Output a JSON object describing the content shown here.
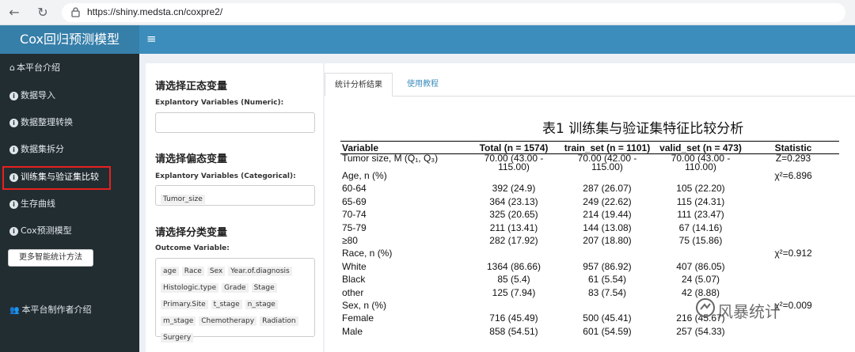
{
  "browser": {
    "url": "https://shiny.medsta.cn/coxpre2/"
  },
  "app": {
    "title": "Cox回归预测模型"
  },
  "sidebar": {
    "items": [
      {
        "label": "本平台介绍",
        "icon": "home-icon"
      },
      {
        "label": "数据导入",
        "icon": "info-icon"
      },
      {
        "label": "数据整理转换",
        "icon": "info-icon"
      },
      {
        "label": "数据集拆分",
        "icon": "info-icon"
      },
      {
        "label": "训练集与验证集比较",
        "icon": "info-icon"
      },
      {
        "label": "生存曲线",
        "icon": "info-icon"
      },
      {
        "label": "Cox预测模型",
        "icon": "info-icon"
      }
    ],
    "more_button": "更多智能统计方法",
    "author": "本平台制作者介绍"
  },
  "left_panel": {
    "numeric_title": "请选择正态变量",
    "numeric_label": "Explantory Variables (Numeric):",
    "categorical_title": "请选择偏态变量",
    "categorical_label": "Explantory Variables (Categorical):",
    "categorical_value": "Tumor_size",
    "outcome_title": "请选择分类变量",
    "outcome_label": "Outcome Variable:",
    "outcome_chips": [
      "age",
      "Race",
      "Sex",
      "Year.of.diagnosis",
      "Histologic.type",
      "Grade",
      "Stage",
      "Primary.Site",
      "t_stage",
      "n_stage",
      "m_stage",
      "Chemotherapy",
      "Radiation",
      "Surgery"
    ]
  },
  "tabs": {
    "active": "统计分析结果",
    "other": "使用教程"
  },
  "table": {
    "title": "表1 训练集与验证集特征比较分析",
    "headers": [
      "Variable",
      "Total (n = 1574)",
      "train_set (n = 1101)",
      "valid_set (n = 473)",
      "Statistic"
    ],
    "rows": [
      [
        "Tumor size, M (Q₁, Q₃)",
        "70.00 (43.00 - 115.00)",
        "70.00 (42.00 - 115.00)",
        "70.00 (43.00 - 110.00)",
        "Z=0.293"
      ],
      [
        "Age, n (%)",
        "",
        "",
        "",
        "χ²=6.896"
      ],
      [
        "60-64",
        "392 (24.9)",
        "287 (26.07)",
        "105 (22.20)",
        ""
      ],
      [
        "65-69",
        "364 (23.13)",
        "249 (22.62)",
        "115 (24.31)",
        ""
      ],
      [
        "70-74",
        "325 (20.65)",
        "214 (19.44)",
        "111 (23.47)",
        ""
      ],
      [
        "75-79",
        "211 (13.41)",
        "144 (13.08)",
        "67 (14.16)",
        ""
      ],
      [
        "≥80",
        "282 (17.92)",
        "207 (18.80)",
        "75 (15.86)",
        ""
      ],
      [
        "Race, n (%)",
        "",
        "",
        "",
        "χ²=0.912"
      ],
      [
        "White",
        "1364 (86.66)",
        "957 (86.92)",
        "407 (86.05)",
        ""
      ],
      [
        "Black",
        "85 (5.4)",
        "61 (5.54)",
        "24 (5.07)",
        ""
      ],
      [
        "other",
        "125 (7.94)",
        "83 (7.54)",
        "42 (8.88)",
        ""
      ],
      [
        "Sex, n (%)",
        "",
        "",
        "",
        "χ²=0.009"
      ],
      [
        "Female",
        "716 (45.49)",
        "500 (45.41)",
        "216 (45.67)",
        ""
      ],
      [
        "Male",
        "858 (54.51)",
        "601 (54.59)",
        "257 (54.33)",
        ""
      ]
    ]
  },
  "watermark": "风暴统计"
}
